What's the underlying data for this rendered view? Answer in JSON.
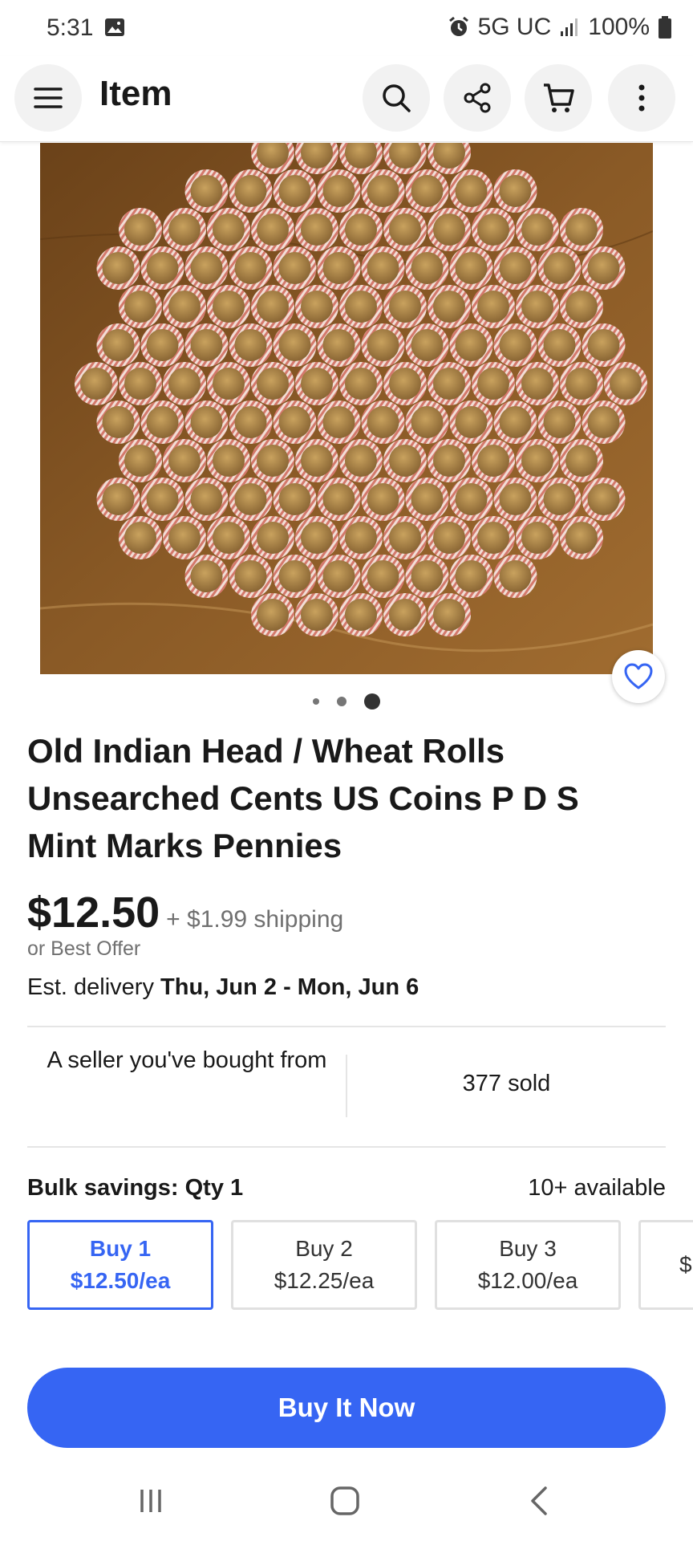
{
  "status_bar": {
    "time": "5:31",
    "network": "5G UC",
    "battery": "100%",
    "icons": [
      "image-icon",
      "alarm-icon",
      "signal-icon",
      "battery-icon"
    ]
  },
  "header": {
    "title": "Item",
    "icons": [
      "menu-icon",
      "search-icon",
      "share-icon",
      "cart-icon",
      "more-icon"
    ]
  },
  "gallery": {
    "image_count": 3,
    "current_index": 3
  },
  "product": {
    "title": "Old Indian Head / Wheat Rolls Unsearched Cents US Coins P D S Mint Marks Pennies",
    "price": "$12.50",
    "shipping": "+ $1.99 shipping",
    "best_offer": "or Best Offer",
    "delivery_prefix": "Est. delivery",
    "delivery_dates": "Thu, Jun 2 - Mon, Jun 6"
  },
  "seller": {
    "note": "A seller you've bought from",
    "sold": "377 sold"
  },
  "bulk": {
    "label": "Bulk savings: Qty 1",
    "available": "10+ available",
    "options": [
      {
        "qty": "Buy 1",
        "price": "$12.50/ea",
        "selected": true
      },
      {
        "qty": "Buy 2",
        "price": "$12.25/ea",
        "selected": false
      },
      {
        "qty": "Buy 3",
        "price": "$12.00/ea",
        "selected": false
      },
      {
        "qty": "",
        "price": "$",
        "selected": false
      }
    ]
  },
  "actions": {
    "buy_now": "Buy It Now"
  },
  "colors": {
    "accent": "#3665f3",
    "text": "#191919",
    "muted": "#707070",
    "photo_wood": "#7a4e1e"
  }
}
